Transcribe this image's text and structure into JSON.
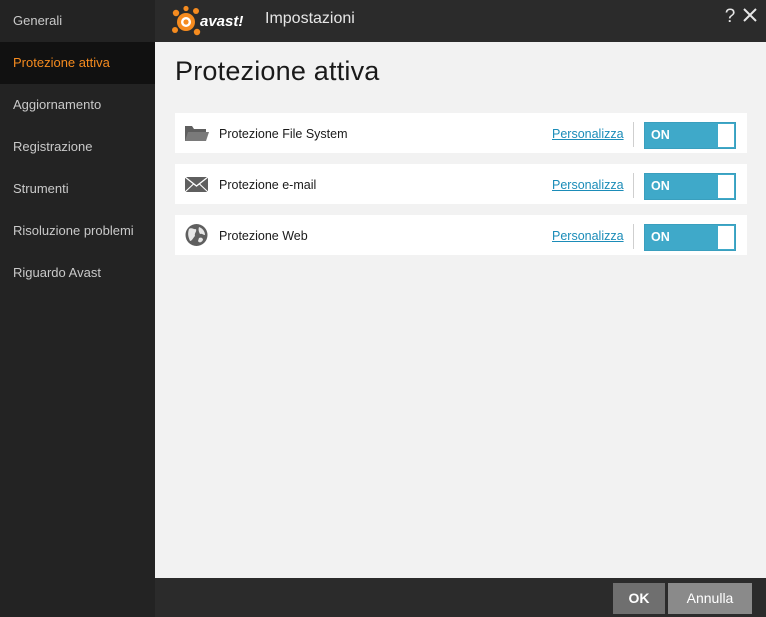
{
  "window": {
    "title": "Impostazioni",
    "help_label": "?"
  },
  "brand": {
    "logo_text": "avast!"
  },
  "sidebar": {
    "items": [
      {
        "label": "Generali",
        "active": false
      },
      {
        "label": "Protezione attiva",
        "active": true
      },
      {
        "label": "Aggiornamento",
        "active": false
      },
      {
        "label": "Registrazione",
        "active": false
      },
      {
        "label": "Strumenti",
        "active": false
      },
      {
        "label": "Risoluzione problemi",
        "active": false
      },
      {
        "label": "Riguardo Avast",
        "active": false
      }
    ]
  },
  "main": {
    "title": "Protezione attiva",
    "shields": [
      {
        "icon": "folder-icon",
        "label": "Protezione File System",
        "link": "Personalizza",
        "toggle": "ON"
      },
      {
        "icon": "envelope-icon",
        "label": "Protezione e-mail",
        "link": "Personalizza",
        "toggle": "ON"
      },
      {
        "icon": "globe-icon",
        "label": "Protezione Web",
        "link": "Personalizza",
        "toggle": "ON"
      }
    ]
  },
  "footer": {
    "ok_label": "OK",
    "cancel_label": "Annulla"
  },
  "colors": {
    "accent": "#f58b1f",
    "toggle_on": "#3fa9c9",
    "link": "#1b8cb8",
    "sidebar_bg": "#232323",
    "sidebar_active_bg": "#111111"
  }
}
